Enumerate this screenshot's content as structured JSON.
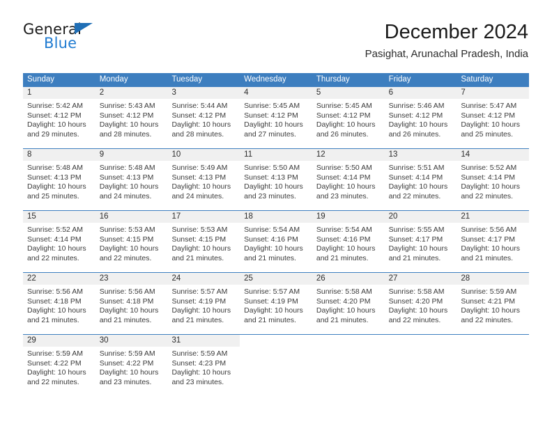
{
  "brand": {
    "name_top": "General",
    "name_bottom": "Blue",
    "accent_color": "#1f7bd1",
    "triangle_color": "#1f6eb5"
  },
  "header": {
    "title": "December 2024",
    "subtitle": "Pasighat, Arunachal Pradesh, India"
  },
  "calendar": {
    "header_bg": "#3d7ebf",
    "daynum_bg": "#f0f0f0",
    "weekdays": [
      "Sunday",
      "Monday",
      "Tuesday",
      "Wednesday",
      "Thursday",
      "Friday",
      "Saturday"
    ],
    "weeks": [
      [
        {
          "day": "1",
          "sunrise": "Sunrise: 5:42 AM",
          "sunset": "Sunset: 4:12 PM",
          "daylight_1": "Daylight: 10 hours",
          "daylight_2": "and 29 minutes."
        },
        {
          "day": "2",
          "sunrise": "Sunrise: 5:43 AM",
          "sunset": "Sunset: 4:12 PM",
          "daylight_1": "Daylight: 10 hours",
          "daylight_2": "and 28 minutes."
        },
        {
          "day": "3",
          "sunrise": "Sunrise: 5:44 AM",
          "sunset": "Sunset: 4:12 PM",
          "daylight_1": "Daylight: 10 hours",
          "daylight_2": "and 28 minutes."
        },
        {
          "day": "4",
          "sunrise": "Sunrise: 5:45 AM",
          "sunset": "Sunset: 4:12 PM",
          "daylight_1": "Daylight: 10 hours",
          "daylight_2": "and 27 minutes."
        },
        {
          "day": "5",
          "sunrise": "Sunrise: 5:45 AM",
          "sunset": "Sunset: 4:12 PM",
          "daylight_1": "Daylight: 10 hours",
          "daylight_2": "and 26 minutes."
        },
        {
          "day": "6",
          "sunrise": "Sunrise: 5:46 AM",
          "sunset": "Sunset: 4:12 PM",
          "daylight_1": "Daylight: 10 hours",
          "daylight_2": "and 26 minutes."
        },
        {
          "day": "7",
          "sunrise": "Sunrise: 5:47 AM",
          "sunset": "Sunset: 4:12 PM",
          "daylight_1": "Daylight: 10 hours",
          "daylight_2": "and 25 minutes."
        }
      ],
      [
        {
          "day": "8",
          "sunrise": "Sunrise: 5:48 AM",
          "sunset": "Sunset: 4:13 PM",
          "daylight_1": "Daylight: 10 hours",
          "daylight_2": "and 25 minutes."
        },
        {
          "day": "9",
          "sunrise": "Sunrise: 5:48 AM",
          "sunset": "Sunset: 4:13 PM",
          "daylight_1": "Daylight: 10 hours",
          "daylight_2": "and 24 minutes."
        },
        {
          "day": "10",
          "sunrise": "Sunrise: 5:49 AM",
          "sunset": "Sunset: 4:13 PM",
          "daylight_1": "Daylight: 10 hours",
          "daylight_2": "and 24 minutes."
        },
        {
          "day": "11",
          "sunrise": "Sunrise: 5:50 AM",
          "sunset": "Sunset: 4:13 PM",
          "daylight_1": "Daylight: 10 hours",
          "daylight_2": "and 23 minutes."
        },
        {
          "day": "12",
          "sunrise": "Sunrise: 5:50 AM",
          "sunset": "Sunset: 4:14 PM",
          "daylight_1": "Daylight: 10 hours",
          "daylight_2": "and 23 minutes."
        },
        {
          "day": "13",
          "sunrise": "Sunrise: 5:51 AM",
          "sunset": "Sunset: 4:14 PM",
          "daylight_1": "Daylight: 10 hours",
          "daylight_2": "and 22 minutes."
        },
        {
          "day": "14",
          "sunrise": "Sunrise: 5:52 AM",
          "sunset": "Sunset: 4:14 PM",
          "daylight_1": "Daylight: 10 hours",
          "daylight_2": "and 22 minutes."
        }
      ],
      [
        {
          "day": "15",
          "sunrise": "Sunrise: 5:52 AM",
          "sunset": "Sunset: 4:14 PM",
          "daylight_1": "Daylight: 10 hours",
          "daylight_2": "and 22 minutes."
        },
        {
          "day": "16",
          "sunrise": "Sunrise: 5:53 AM",
          "sunset": "Sunset: 4:15 PM",
          "daylight_1": "Daylight: 10 hours",
          "daylight_2": "and 22 minutes."
        },
        {
          "day": "17",
          "sunrise": "Sunrise: 5:53 AM",
          "sunset": "Sunset: 4:15 PM",
          "daylight_1": "Daylight: 10 hours",
          "daylight_2": "and 21 minutes."
        },
        {
          "day": "18",
          "sunrise": "Sunrise: 5:54 AM",
          "sunset": "Sunset: 4:16 PM",
          "daylight_1": "Daylight: 10 hours",
          "daylight_2": "and 21 minutes."
        },
        {
          "day": "19",
          "sunrise": "Sunrise: 5:54 AM",
          "sunset": "Sunset: 4:16 PM",
          "daylight_1": "Daylight: 10 hours",
          "daylight_2": "and 21 minutes."
        },
        {
          "day": "20",
          "sunrise": "Sunrise: 5:55 AM",
          "sunset": "Sunset: 4:17 PM",
          "daylight_1": "Daylight: 10 hours",
          "daylight_2": "and 21 minutes."
        },
        {
          "day": "21",
          "sunrise": "Sunrise: 5:56 AM",
          "sunset": "Sunset: 4:17 PM",
          "daylight_1": "Daylight: 10 hours",
          "daylight_2": "and 21 minutes."
        }
      ],
      [
        {
          "day": "22",
          "sunrise": "Sunrise: 5:56 AM",
          "sunset": "Sunset: 4:18 PM",
          "daylight_1": "Daylight: 10 hours",
          "daylight_2": "and 21 minutes."
        },
        {
          "day": "23",
          "sunrise": "Sunrise: 5:56 AM",
          "sunset": "Sunset: 4:18 PM",
          "daylight_1": "Daylight: 10 hours",
          "daylight_2": "and 21 minutes."
        },
        {
          "day": "24",
          "sunrise": "Sunrise: 5:57 AM",
          "sunset": "Sunset: 4:19 PM",
          "daylight_1": "Daylight: 10 hours",
          "daylight_2": "and 21 minutes."
        },
        {
          "day": "25",
          "sunrise": "Sunrise: 5:57 AM",
          "sunset": "Sunset: 4:19 PM",
          "daylight_1": "Daylight: 10 hours",
          "daylight_2": "and 21 minutes."
        },
        {
          "day": "26",
          "sunrise": "Sunrise: 5:58 AM",
          "sunset": "Sunset: 4:20 PM",
          "daylight_1": "Daylight: 10 hours",
          "daylight_2": "and 21 minutes."
        },
        {
          "day": "27",
          "sunrise": "Sunrise: 5:58 AM",
          "sunset": "Sunset: 4:20 PM",
          "daylight_1": "Daylight: 10 hours",
          "daylight_2": "and 22 minutes."
        },
        {
          "day": "28",
          "sunrise": "Sunrise: 5:59 AM",
          "sunset": "Sunset: 4:21 PM",
          "daylight_1": "Daylight: 10 hours",
          "daylight_2": "and 22 minutes."
        }
      ],
      [
        {
          "day": "29",
          "sunrise": "Sunrise: 5:59 AM",
          "sunset": "Sunset: 4:22 PM",
          "daylight_1": "Daylight: 10 hours",
          "daylight_2": "and 22 minutes."
        },
        {
          "day": "30",
          "sunrise": "Sunrise: 5:59 AM",
          "sunset": "Sunset: 4:22 PM",
          "daylight_1": "Daylight: 10 hours",
          "daylight_2": "and 23 minutes."
        },
        {
          "day": "31",
          "sunrise": "Sunrise: 5:59 AM",
          "sunset": "Sunset: 4:23 PM",
          "daylight_1": "Daylight: 10 hours",
          "daylight_2": "and 23 minutes."
        },
        {
          "day": "",
          "sunrise": "",
          "sunset": "",
          "daylight_1": "",
          "daylight_2": ""
        },
        {
          "day": "",
          "sunrise": "",
          "sunset": "",
          "daylight_1": "",
          "daylight_2": ""
        },
        {
          "day": "",
          "sunrise": "",
          "sunset": "",
          "daylight_1": "",
          "daylight_2": ""
        },
        {
          "day": "",
          "sunrise": "",
          "sunset": "",
          "daylight_1": "",
          "daylight_2": ""
        }
      ]
    ]
  }
}
